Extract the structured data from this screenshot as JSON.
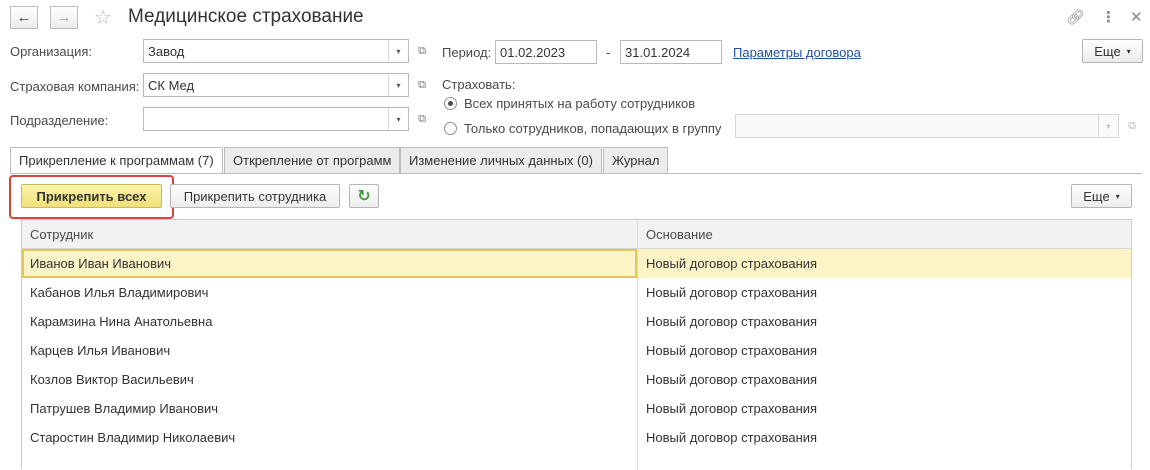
{
  "window": {
    "title": "Медицинское страхование"
  },
  "form": {
    "organization_label": "Организация:",
    "organization_value": "Завод",
    "insurer_label": "Страховая компания:",
    "insurer_value": "СК Мед",
    "department_label": "Подразделение:",
    "department_value": "",
    "period_label": "Период:",
    "period_from": "01.02.2023",
    "period_separator": "-",
    "period_to": "31.01.2024",
    "contract_params_link": "Параметры договора",
    "more_label": "Еще",
    "insure_label": "Страховать:",
    "radio_all": "Всех принятых на работу сотрудников",
    "radio_group": "Только сотрудников, попадающих в группу",
    "group_value": ""
  },
  "tabs": [
    {
      "label": "Прикрепление к программам (7)"
    },
    {
      "label": "Открепление от программ"
    },
    {
      "label": "Изменение личных данных (0)"
    },
    {
      "label": "Журнал"
    }
  ],
  "toolbar": {
    "attach_all": "Прикрепить всех",
    "attach_employee": "Прикрепить сотрудника",
    "more_label": "Еще"
  },
  "table": {
    "columns": [
      "Сотрудник",
      "Основание"
    ],
    "rows": [
      {
        "employee": "Иванов Иван Иванович",
        "basis": "Новый договор страхования"
      },
      {
        "employee": "Кабанов Илья Владимирович",
        "basis": "Новый договор страхования"
      },
      {
        "employee": "Карамзина Нина Анатольевна",
        "basis": "Новый договор страхования"
      },
      {
        "employee": "Карцев Илья Иванович",
        "basis": "Новый договор страхования"
      },
      {
        "employee": "Козлов Виктор Васильевич",
        "basis": "Новый договор страхования"
      },
      {
        "employee": "Патрушев Владимир Иванович",
        "basis": "Новый договор страхования"
      },
      {
        "employee": "Старостин Владимир Николаевич",
        "basis": "Новый договор страхования"
      }
    ]
  },
  "colors": {
    "highlight_button": "#f5e98e",
    "highlight_outline": "#d9453b",
    "selected_row": "#fcf3c6",
    "link": "#1f4fa8"
  }
}
